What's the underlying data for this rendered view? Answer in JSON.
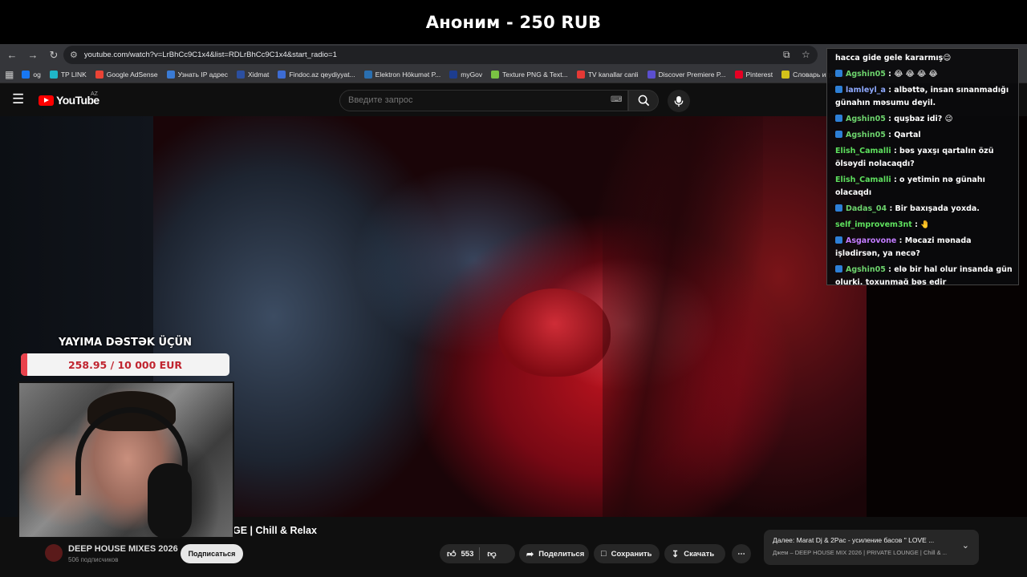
{
  "donation_alert": {
    "text": "Аноним - 250 RUB"
  },
  "browser": {
    "url": "youtube.com/watch?v=LrBhCc9C1x4&list=RDLrBhCc9C1x4&start_radio=1",
    "bookmarks": [
      {
        "label": "og",
        "color": "#1877f2"
      },
      {
        "label": "TP LINK",
        "color": "#1fb6c8"
      },
      {
        "label": "Google AdSense",
        "color": "#ea4335"
      },
      {
        "label": "Узнать IP адрес",
        "color": "#3a7bd5"
      },
      {
        "label": "Xidmat",
        "color": "#2b4fa0"
      },
      {
        "label": "Findoc.az qeydiyyat...",
        "color": "#3d6cd4"
      },
      {
        "label": "Elektron Hökumət P...",
        "color": "#2a6fb0"
      },
      {
        "label": "myGov",
        "color": "#1d3d8f"
      },
      {
        "label": "Texture PNG & Text...",
        "color": "#7ac143"
      },
      {
        "label": "TV kanallar canli",
        "color": "#e53935"
      },
      {
        "label": "Discover Premiere P...",
        "color": "#5b4fcf"
      },
      {
        "label": "Pinterest",
        "color": "#e60023"
      },
      {
        "label": "Словарь игровых т...",
        "color": "#d4c21a"
      }
    ]
  },
  "youtube": {
    "logo_text": "YouTube",
    "region": "AZ",
    "search_placeholder": "Введите запрос"
  },
  "video": {
    "title": "GE | Chill & Relax",
    "channel": "DEEP HOUSE MIXES 2026",
    "subscribers": "506 подписчиков",
    "subscribe_label": "Подписаться",
    "likes": "553",
    "share_label": "Поделиться",
    "save_label": "Сохранить",
    "download_label": "Скачать"
  },
  "up_next": {
    "title": "Далее: Marat Dj & 2Pac - усиление басов \" LOVE ...",
    "subtitle": "Джем – DEEP HOUSE MIX 2026 | PRIVATE LOUNGE | Chill & ..."
  },
  "donation_goal": {
    "title": "YAYIMA DƏSTƏK ÜÇÜN",
    "progress_text": "258.95 / 10 000 EUR",
    "raised": 258.95,
    "target": 10000,
    "fill_color": "#e9424c"
  },
  "chat": {
    "messages": [
      {
        "user": "",
        "text": "hacca gide gele kararmış😉",
        "color": "#ffffff",
        "badge": false
      },
      {
        "user": "Agshin05",
        "text": ": 😂 😂 😂 😂",
        "color": "#6dd36d",
        "badge": true
      },
      {
        "user": "lamleyl_a",
        "text": ": albəttə, insan sınanmadığı günahın məsumu deyil.",
        "color": "#8ea9ff",
        "badge": true
      },
      {
        "user": "Agshin05",
        "text": ": quşbaz idi? 😉",
        "color": "#6dd36d",
        "badge": true
      },
      {
        "user": "Agshin05",
        "text": ": Qartal",
        "color": "#6dd36d",
        "badge": true
      },
      {
        "user": "Elish_Camalli",
        "text": ": bəs yaxşı qartalın özü ölsəydi nolacaqdı?",
        "color": "#5ee05e",
        "badge": false
      },
      {
        "user": "Elish_Camalli",
        "text": ": o yetimin nə günahı olacaqdı",
        "color": "#5ee05e",
        "badge": false
      },
      {
        "user": "Dadas_04",
        "text": ": Bir baxışada yoxda.",
        "color": "#6dd36d",
        "badge": true
      },
      {
        "user": "self_improvem3nt",
        "text": ": 🤚",
        "color": "#5ee05e",
        "badge": false
      },
      {
        "user": "Asgarovone",
        "text": ": Məcazi mənada işlədirsən, ya necə?",
        "color": "#c27cff",
        "badge": true
      },
      {
        "user": "Agshin05",
        "text": ": elə bir hal olur insanda gün olurki, toxunmağ bəs edir",
        "color": "#6dd36d",
        "badge": true
      }
    ]
  }
}
